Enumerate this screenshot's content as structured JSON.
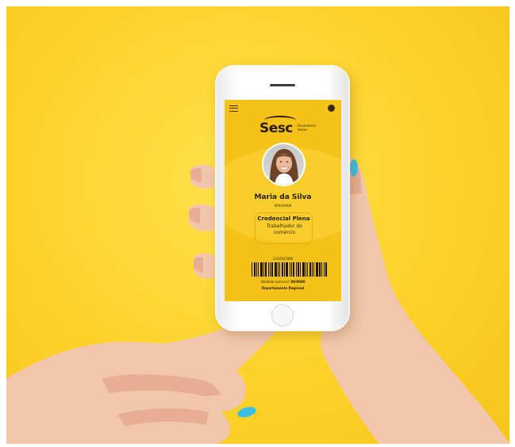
{
  "scene": {
    "background_color": "#fcd22a",
    "nail_color": "#3dbfe3",
    "skin_color": "#f2c6ad"
  },
  "screen": {
    "background_color": "#f5c21a",
    "topbar": {
      "menu_icon": "hamburger-menu-icon",
      "profile_icon": "user-icon"
    },
    "logo": {
      "word": "Sesc",
      "sub_line1": "Fecomércio",
      "sub_line2": "Senac"
    },
    "profile": {
      "name": "Maria da Silva",
      "code": "0000/0000",
      "credential_title": "Credencial Plena",
      "credential_subtitle": "Trabalhador do comércio"
    },
    "barcode": {
      "number": "1234567890"
    },
    "validity_label": "Validade nacional:",
    "validity_value": "00/0000",
    "department": "Departamento Regional"
  }
}
